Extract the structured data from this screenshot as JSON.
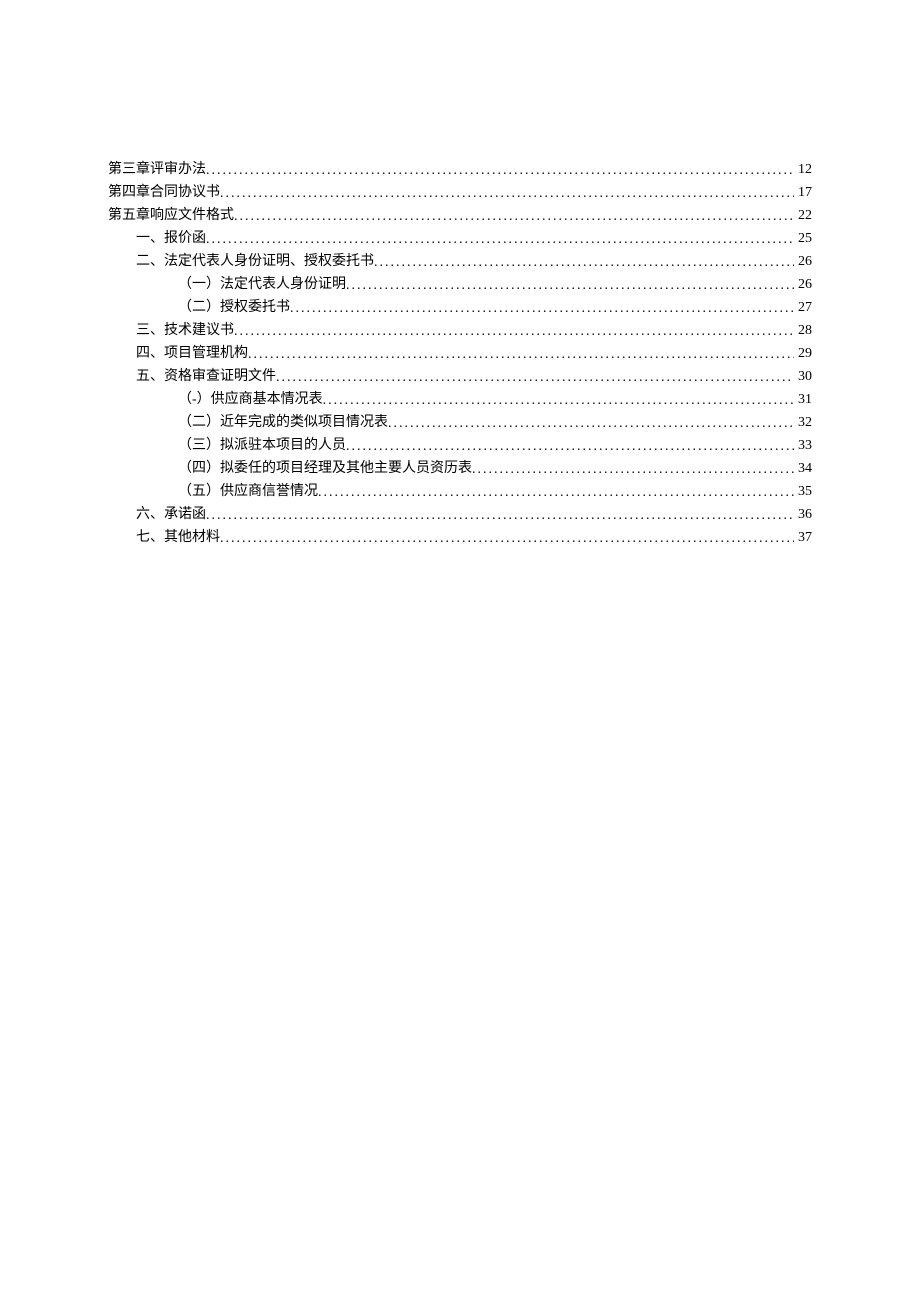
{
  "toc": [
    {
      "label": "第三章评审办法",
      "page": "12",
      "indent": 0
    },
    {
      "label": "第四章合同协议书",
      "page": "17",
      "indent": 0
    },
    {
      "label": "第五章响应文件格式",
      "page": "22",
      "indent": 0
    },
    {
      "label": "一、报价函",
      "page": "25",
      "indent": 1
    },
    {
      "label": "二、法定代表人身份证明、授权委托书",
      "page": "26",
      "indent": 1
    },
    {
      "label": "（一）法定代表人身份证明",
      "page": "26",
      "indent": 2
    },
    {
      "label": "（二）授权委托书",
      "page": "27",
      "indent": 2
    },
    {
      "label": "三、技术建议书",
      "page": "28",
      "indent": 1
    },
    {
      "label": "四、项目管理机构",
      "page": "29",
      "indent": 1
    },
    {
      "label": "五、资格审查证明文件",
      "page": "30",
      "indent": 1
    },
    {
      "label": "（-）供应商基本情况表",
      "page": "31",
      "indent": 2
    },
    {
      "label": "（二）近年完成的类似项目情况表",
      "page": "32",
      "indent": 2
    },
    {
      "label": "（三）拟派驻本项目的人员",
      "page": "33",
      "indent": 2
    },
    {
      "label": "（四）拟委任的项目经理及其他主要人员资历表",
      "page": "34",
      "indent": 2
    },
    {
      "label": "（五）供应商信誉情况",
      "page": "35",
      "indent": 2
    },
    {
      "label": "六、承诺函",
      "page": "36",
      "indent": 1
    },
    {
      "label": "七、其他材料",
      "page": "37",
      "indent": 1
    }
  ]
}
